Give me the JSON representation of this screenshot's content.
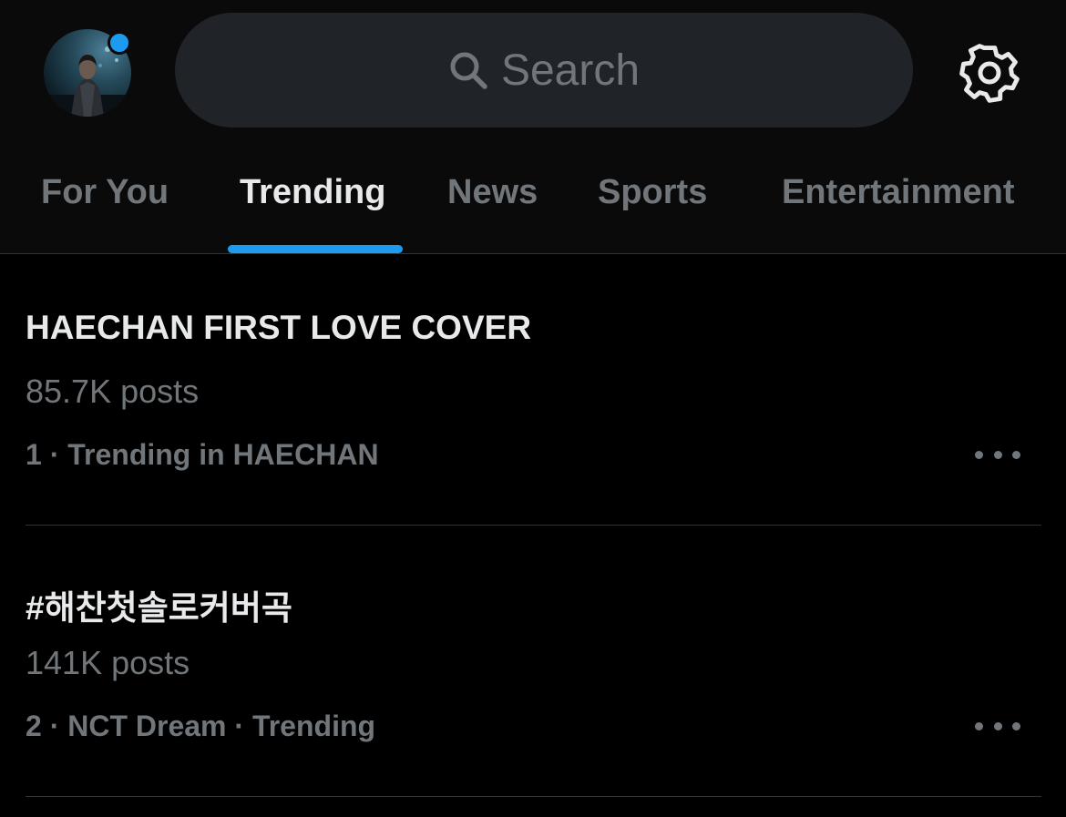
{
  "search": {
    "placeholder": "Search",
    "icon": "search-icon"
  },
  "settings": {
    "icon": "gear-icon"
  },
  "profile": {
    "icon": "avatar",
    "notification_color": "#1d9bf0"
  },
  "tabs": [
    {
      "label": "For You",
      "active": false
    },
    {
      "label": "Trending",
      "active": true
    },
    {
      "label": "News",
      "active": false
    },
    {
      "label": "Sports",
      "active": false
    },
    {
      "label": "Entertainment",
      "active": false
    }
  ],
  "trends": [
    {
      "title": "HAECHAN FIRST LOVE COVER",
      "posts": "85.7K posts",
      "context": "1 · Trending in HAECHAN"
    },
    {
      "title": "#해찬첫솔로커버곡",
      "posts": "141K posts",
      "context": "2 · NCT Dream · Trending"
    }
  ],
  "colors": {
    "accent": "#1d9bf0",
    "background": "#000000",
    "header_background": "#0a0a0b",
    "primary_text": "#e7e9ea",
    "secondary_text": "#71767b",
    "divider": "#2f3336",
    "search_background": "#202327"
  }
}
